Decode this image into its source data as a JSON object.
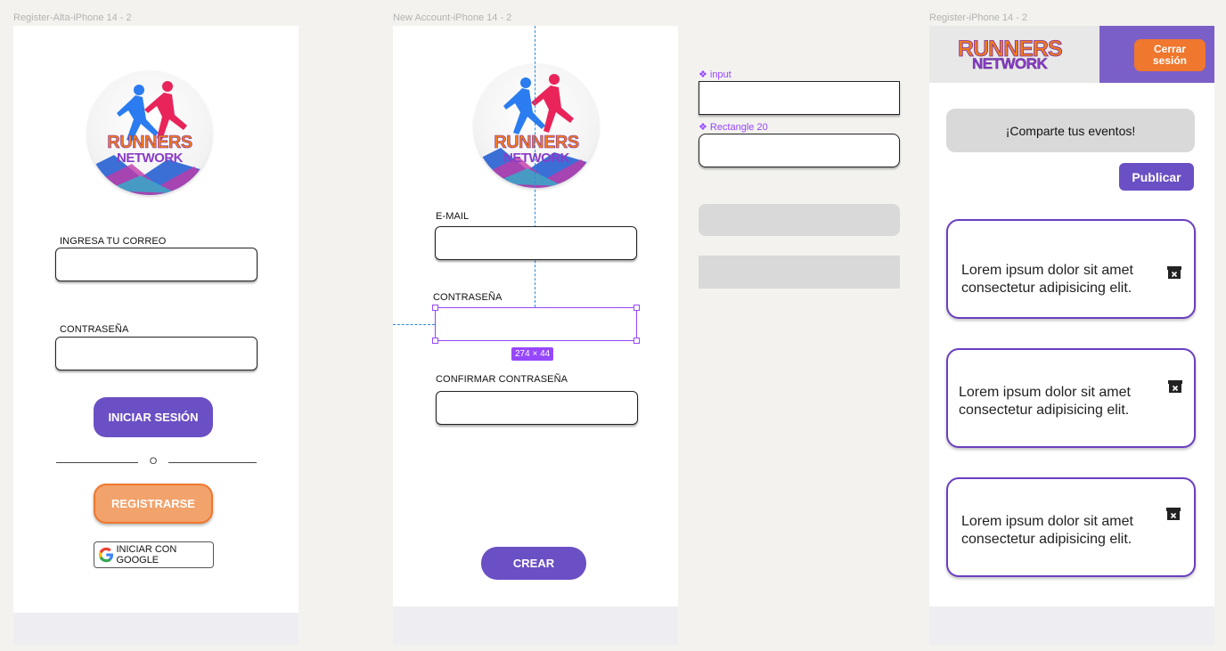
{
  "frames": {
    "login": {
      "label": "Register-Alta-iPhone 14 - 2"
    },
    "new_account": {
      "label": "New Account-iPhone 14 - 2"
    },
    "feed": {
      "label": "Register-iPhone 14 - 2"
    }
  },
  "logo": {
    "line1": "RUNNERS",
    "line2": "NETWORK"
  },
  "login": {
    "email_label": "INGRESA TU CORREO",
    "password_label": "CONTRASEÑA",
    "login_button": "INICIAR SESIÓN",
    "divider_text": "O",
    "register_button": "REGISTRARSE",
    "google_button": "INICIAR CON GOOGLE"
  },
  "new_account": {
    "email_label": "E-MAIL",
    "password_label": "CONTRASEÑA",
    "selection_size": "274 × 44",
    "confirm_label": "CONFIRMAR CONTRASEÑA",
    "create_button": "CREAR"
  },
  "components": {
    "input_label": "input",
    "rect_label": "Rectangle 20"
  },
  "feed": {
    "logout_button_line1": "Cerrar",
    "logout_button_line2": "sesión",
    "share_prompt": "¡Comparte tus eventos!",
    "publish_button": "Publicar",
    "posts": [
      {
        "text": "Lorem ipsum dolor sit amet consectetur adipisicing elit."
      },
      {
        "text": "Lorem ipsum dolor sit amet consectetur adipisicing elit."
      },
      {
        "text": "Lorem ipsum dolor sit amet consectetur adipisicing elit."
      }
    ]
  },
  "colors": {
    "purple": "#6b4fc4",
    "orange_soft": "#f2a26b",
    "orange": "#f0772e",
    "selection": "#9747ff",
    "gray_block": "#d9d9d9"
  }
}
